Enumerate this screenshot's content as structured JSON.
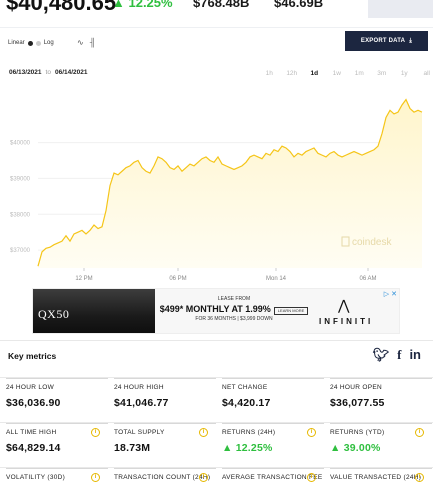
{
  "top": {
    "price": "$40,480.65",
    "change": "12.25%",
    "volume": "$768.48B",
    "market_cap": "$46.69B"
  },
  "chart_controls": {
    "linear_label": "Linear",
    "log_label": "Log",
    "export_label": "EXPORT DATA",
    "date_from": "06/13/2021",
    "date_to_word": "to",
    "date_to": "06/14/2021",
    "ranges": [
      "1h",
      "12h",
      "1d",
      "1w",
      "1m",
      "3m",
      "1y",
      "all"
    ],
    "active_range": "1d",
    "watermark": "coindesk"
  },
  "chart_data": {
    "type": "area",
    "y_ticks": [
      "$40000",
      "$39000",
      "$38000",
      "$37000"
    ],
    "x_ticks": [
      "12 PM",
      "06 PM",
      "Mon 14",
      "06 AM"
    ],
    "ylim": [
      36500,
      41300
    ],
    "x": [
      0,
      1,
      2,
      3,
      4,
      5,
      6,
      7,
      8,
      9,
      10,
      11,
      12,
      13,
      14,
      15,
      16,
      17,
      18,
      19,
      20,
      21,
      22,
      23,
      24,
      25,
      26,
      27,
      28,
      29,
      30,
      31,
      32,
      33,
      34,
      35,
      36,
      37,
      38,
      39,
      40,
      41,
      42,
      43,
      44,
      45,
      46,
      47,
      48,
      49,
      50,
      51,
      52,
      53,
      54,
      55,
      56,
      57,
      58,
      59,
      60,
      61,
      62,
      63,
      64,
      65,
      66,
      67,
      68,
      69,
      70,
      71,
      72,
      73,
      74,
      75,
      76,
      77,
      78,
      79,
      80,
      81,
      82,
      83,
      84,
      85,
      86,
      87,
      88,
      89,
      90,
      91,
      92,
      93,
      94,
      95,
      96
    ],
    "y": [
      36550,
      36950,
      37050,
      37080,
      37150,
      37200,
      37250,
      37400,
      37250,
      37450,
      37500,
      37550,
      37450,
      37550,
      37700,
      37600,
      37650,
      38100,
      38800,
      39150,
      39100,
      39200,
      39300,
      39350,
      39450,
      39500,
      39300,
      39200,
      39150,
      39350,
      39600,
      39550,
      39450,
      39300,
      39250,
      39350,
      39200,
      39300,
      39400,
      39350,
      39450,
      39550,
      39600,
      39500,
      39450,
      39600,
      39400,
      39350,
      39300,
      39250,
      39300,
      39350,
      39450,
      39600,
      39650,
      39600,
      39550,
      39700,
      39650,
      39800,
      39750,
      39900,
      39850,
      39750,
      39600,
      39700,
      39650,
      39750,
      39800,
      39850,
      39700,
      39650,
      39600,
      39700,
      39750,
      39650,
      39600,
      39650,
      39700,
      39750,
      39700,
      39650,
      39700,
      39750,
      39800,
      39900,
      40250,
      40700,
      40900,
      40800,
      40850,
      41050,
      41200,
      40950,
      40850,
      40900,
      40850
    ]
  },
  "ad": {
    "model": "QX50",
    "lease_line": "LEASE FROM",
    "price_line": "$499* MONTHLY AT 1.99%",
    "terms_line": "FOR 36 MONTHS | $3,999 DOWN",
    "learn_more": "LEARN MORE",
    "brand": "INFINITI"
  },
  "metrics": {
    "title": "Key metrics",
    "rows": [
      [
        {
          "label": "24 HOUR LOW",
          "value": "$36,036.90",
          "info": false,
          "up": false
        },
        {
          "label": "24 HOUR HIGH",
          "value": "$41,046.77",
          "info": false,
          "up": false
        },
        {
          "label": "NET CHANGE",
          "value": "$4,420.17",
          "info": false,
          "up": false
        },
        {
          "label": "24 HOUR OPEN",
          "value": "$36,077.55",
          "info": false,
          "up": false
        }
      ],
      [
        {
          "label": "ALL TIME HIGH",
          "value": "$64,829.14",
          "info": true,
          "up": false
        },
        {
          "label": "TOTAL SUPPLY",
          "value": "18.73M",
          "info": true,
          "up": false
        },
        {
          "label": "RETURNS (24H)",
          "value": "12.25%",
          "info": true,
          "up": true
        },
        {
          "label": "RETURNS (YTD)",
          "value": "39.00%",
          "info": true,
          "up": true
        }
      ],
      [
        {
          "label": "VOLATILITY (30D)",
          "value": "",
          "info": true,
          "up": false
        },
        {
          "label": "TRANSACTION COUNT (24H)",
          "value": "",
          "info": true,
          "up": false
        },
        {
          "label": "AVERAGE TRANSACTION FEE",
          "value": "",
          "info": true,
          "up": false
        },
        {
          "label": "VALUE TRANSACTED (24H)",
          "value": "",
          "info": true,
          "up": false
        }
      ]
    ]
  },
  "colors": {
    "accent_green": "#2fbf3f",
    "chart_line": "#f5c518",
    "chart_fill": "#fff5cc",
    "export_bg": "#1c2640",
    "info_yellow": "#e6b800"
  }
}
